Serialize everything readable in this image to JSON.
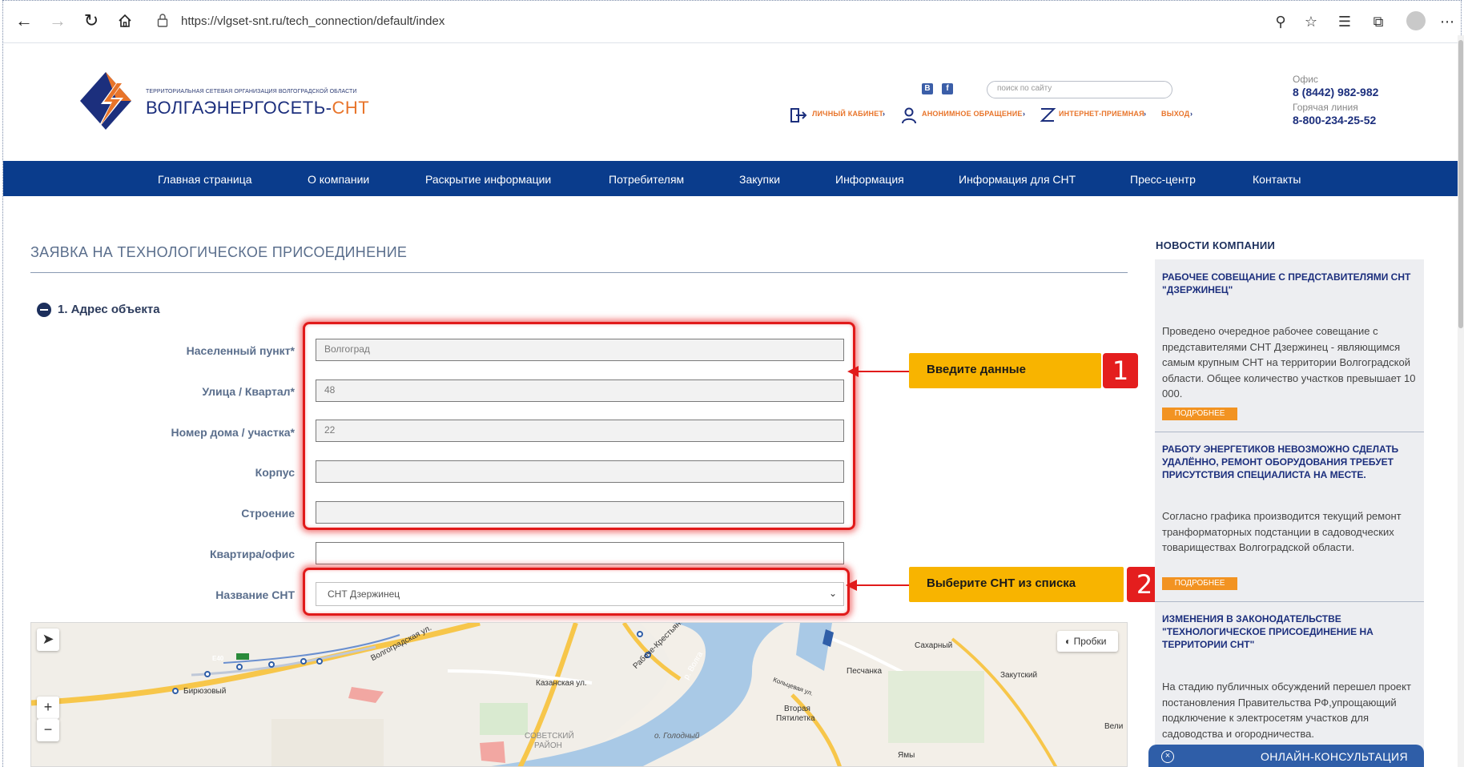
{
  "browser": {
    "url": "https://vlgset-snt.ru/tech_connection/default/index"
  },
  "header": {
    "logo_sub": "ТЕРРИТОРИАЛЬНАЯ СЕТЕВАЯ ОРГАНИЗАЦИЯ ВОЛГОГРАДСКОЙ ОБЛАСТИ",
    "logo_main": "ВОЛГАЭНЕРГОСЕТЬ-",
    "logo_accent": "СНТ",
    "social_vk": "В",
    "social_fb": "f",
    "search_placeholder": "поиск по сайту",
    "links": {
      "cabinet": "ЛИЧНЫЙ КАБИНЕТ",
      "anonymous": "АНОНИМНОЕ ОБРАЩЕНИЕ",
      "reception": "ИНТЕРНЕТ-ПРИЕМНАЯ",
      "logout": "ВЫХОД"
    },
    "office_label": "Офис",
    "office_phone": "8 (8442) 982-982",
    "hotline_label": "Горячая линия",
    "hotline_phone": "8-800-234-25-52"
  },
  "nav": [
    "Главная страница",
    "О компании",
    "Раскрытие информации",
    "Потребителям",
    "Закупки",
    "Информация",
    "Информация для СНТ",
    "Пресс-центр",
    "Контакты"
  ],
  "form": {
    "title": "ЗАЯВКА НА ТЕХНОЛОГИЧЕСКОЕ ПРИСОЕДИНЕНИЕ",
    "section": "1. Адрес объекта",
    "fields": {
      "settlement_label": "Населенный пункт*",
      "settlement_value": "Волгоград",
      "street_label": "Улица / Квартал*",
      "street_value": "48",
      "house_label": "Номер дома / участка*",
      "house_value": "22",
      "block_label": "Корпус",
      "block_value": "",
      "building_label": "Строение",
      "building_value": "",
      "apartment_label": "Квартира/офис",
      "apartment_value": "",
      "snt_label": "Название СНТ",
      "snt_value": "СНТ Дзержинец"
    }
  },
  "callouts": {
    "c1_text": "Введите данные",
    "c1_num": "1",
    "c2_text": "Выберите СНТ из списка",
    "c2_num": "2"
  },
  "map": {
    "traffic": "Пробки",
    "labels": {
      "birjuzovy": "Бирюзовый",
      "e40": "E40",
      "volgogradskaya": "Волгоградская ул.",
      "kazanskaya": "Казанская ул.",
      "raboche": "Рабоче-Крестьянск.",
      "volga": "р. Волга",
      "sakharny": "Сахарный",
      "peschanka": "Песчанка",
      "zakutsky": "Закутский",
      "koltsevaya": "Кольцевая ул.",
      "vtoraya": "Вторая",
      "pyatiletka": "Пятилетка",
      "sovetsky1": "СОВЕТСКИЙ",
      "sovetsky2": "РАЙОН",
      "golodny": "о. Голодный",
      "yamy": "Ямы",
      "veli": "Вели"
    }
  },
  "sidebar": {
    "heading": "НОВОСТИ КОМПАНИИ",
    "more": "ПОДРОБНЕЕ",
    "news": [
      {
        "title": "РАБОЧЕЕ СОВЕЩАНИЕ С ПРЕДСТАВИТЕЛЯМИ СНТ \"ДЗЕРЖИНЕЦ\"",
        "text": "Проведено очередное рабочее совещание с представителями СНТ Дзержинец - являющимся самым крупным СНТ на территории Волгоградской области. Общее количество участков превышает 10 000."
      },
      {
        "title": "РАБОТУ ЭНЕРГЕТИКОВ НЕВОЗМОЖНО СДЕЛАТЬ УДАЛЁННО, РЕМОНТ ОБОРУДОВАНИЯ ТРЕБУЕТ ПРИСУТСТВИЯ СПЕЦИАЛИСТА НА МЕСТЕ.",
        "text": "Согласно графика производится текущий ремонт транформаторных подстанции в садоводческих товариществах Волгоградской области."
      },
      {
        "title": "ИЗМЕНЕНИЯ В ЗАКОНОДАТЕЛЬСТВЕ \"ТЕХНОЛОГИЧЕСКОЕ ПРИСОЕДИНЕНИЕ НА ТЕРРИТОРИИ СНТ\"",
        "text": "На стадию публичных обсуждений перешел проект постановления Правительства РФ,упрощающий подключение к электросетям участков для садоводства и огородничества."
      }
    ],
    "consult": "ОНЛАЙН-КОНСУЛЬТАЦИЯ"
  }
}
